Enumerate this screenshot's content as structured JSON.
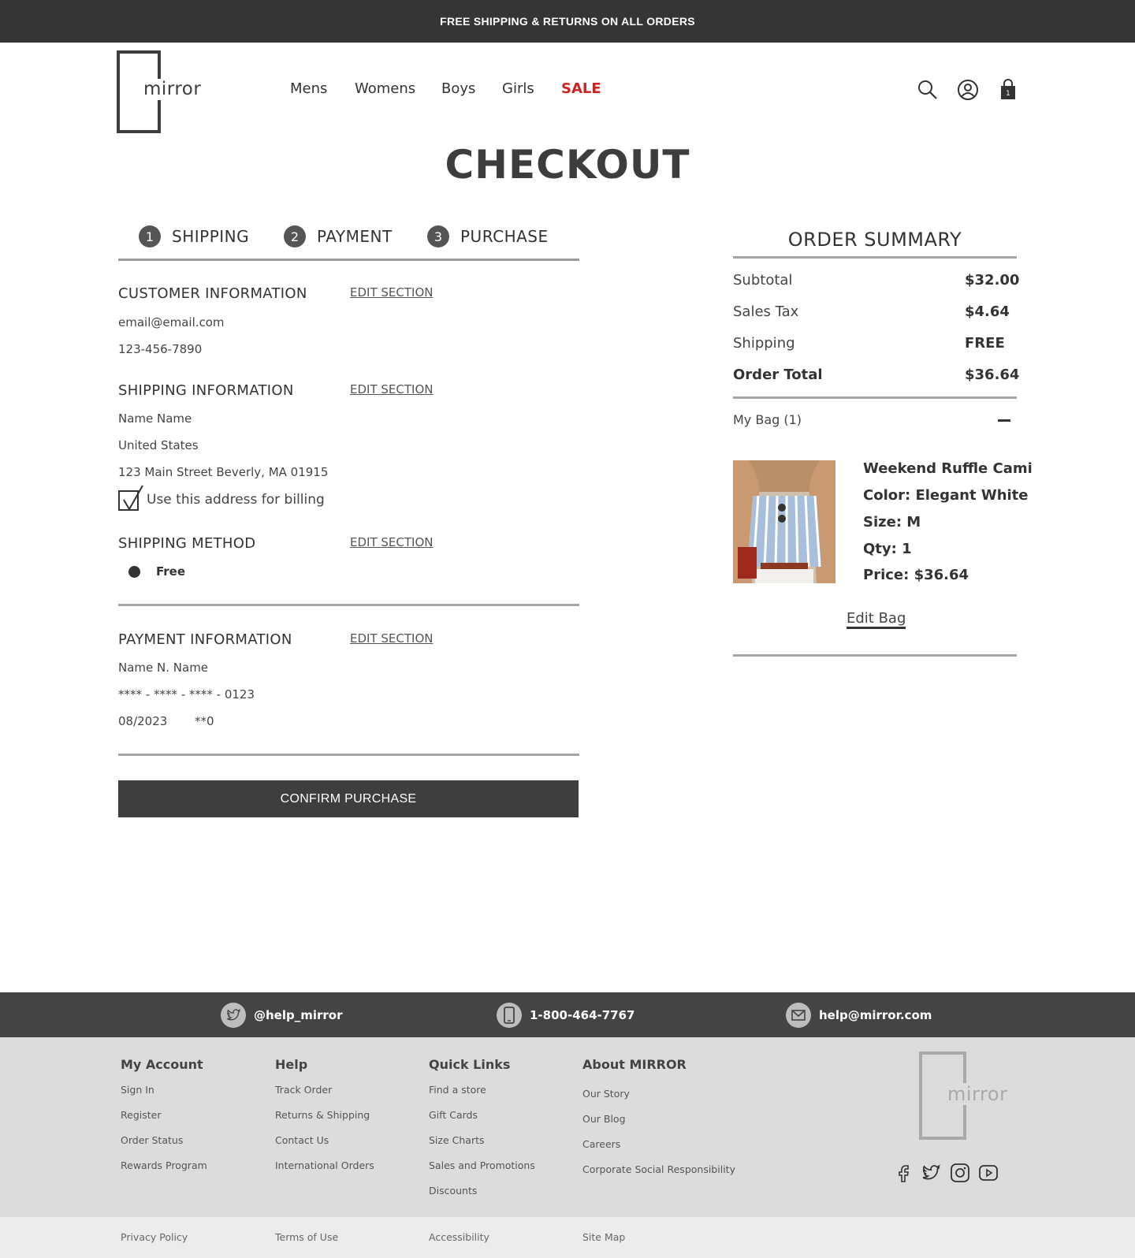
{
  "announcement": "FREE SHIPPING & RETURNS ON ALL ORDERS",
  "brand": {
    "logo_text": "mirror"
  },
  "nav": {
    "mens": "Mens",
    "womens": "Womens",
    "boys": "Boys",
    "girls": "Girls",
    "sale": "SALE"
  },
  "header_icons": {
    "search": "search-icon",
    "account": "account-icon",
    "bag": "bag-icon",
    "bag_count": "1"
  },
  "page_title": "CHECKOUT",
  "steps": [
    {
      "num": "1",
      "label": "SHIPPING"
    },
    {
      "num": "2",
      "label": "PAYMENT"
    },
    {
      "num": "3",
      "label": "PURCHASE"
    }
  ],
  "edit_section_label": "EDIT SECTION",
  "customer": {
    "heading": "CUSTOMER INFORMATION",
    "email": "email@email.com",
    "phone": "123-456-7890"
  },
  "shipping_info": {
    "heading": "SHIPPING INFORMATION",
    "name": "Name Name",
    "country": "United States",
    "address": "123 Main Street Beverly, MA 01915",
    "billing_checkbox_label": "Use this address for billing",
    "billing_checked": true
  },
  "shipping_method": {
    "heading": "SHIPPING METHOD",
    "option": "Free"
  },
  "payment": {
    "heading": "PAYMENT INFORMATION",
    "name": "Name N. Name",
    "card": "**** - **** - **** - 0123",
    "expiry": "08/2023",
    "cvv": "**0"
  },
  "confirm_button": "CONFIRM PURCHASE",
  "order_summary": {
    "title": "ORDER SUMMARY",
    "rows": [
      {
        "label": "Subtotal",
        "value": "$32.00"
      },
      {
        "label": "Sales Tax",
        "value": "$4.64"
      },
      {
        "label": "Shipping",
        "value": "FREE"
      },
      {
        "label": "Order Total",
        "value": "$36.64"
      }
    ],
    "bag_label": "My Bag (1)",
    "item": {
      "name": "Weekend Ruffle Cami",
      "color": "Color: Elegant White",
      "size": "Size: M",
      "qty": "Qty: 1",
      "price": "Price: $36.64"
    },
    "edit_bag": "Edit Bag"
  },
  "contact": {
    "twitter": "@help_mirror",
    "phone": "1-800-464-7767",
    "email": "help@mirror.com"
  },
  "footer": {
    "columns": [
      {
        "heading": "My Account",
        "links": [
          "Sign In",
          "Register",
          "Order Status",
          "Rewards Program"
        ]
      },
      {
        "heading": "Help",
        "links": [
          "Track Order",
          "Returns & Shipping",
          "Contact Us",
          "International Orders"
        ]
      },
      {
        "heading": "Quick Links",
        "links": [
          "Find a store",
          "Gift Cards",
          "Size Charts",
          "Sales and Promotions",
          "Discounts"
        ]
      },
      {
        "heading": "About MIRROR",
        "links": [
          "Our Story",
          "Our Blog",
          "Careers",
          "Corporate Social Responsibility"
        ]
      }
    ],
    "logo_text": "mirror",
    "social": [
      "facebook-icon",
      "twitter-icon",
      "instagram-icon",
      "youtube-icon"
    ],
    "bottom_links": [
      "Privacy Policy",
      "Terms of Use",
      "Accessibility",
      "Site Map"
    ]
  },
  "colors": {
    "sale": "#cc2222",
    "dark": "#3e3e3e",
    "footer_bg": "#dcdcdc"
  }
}
